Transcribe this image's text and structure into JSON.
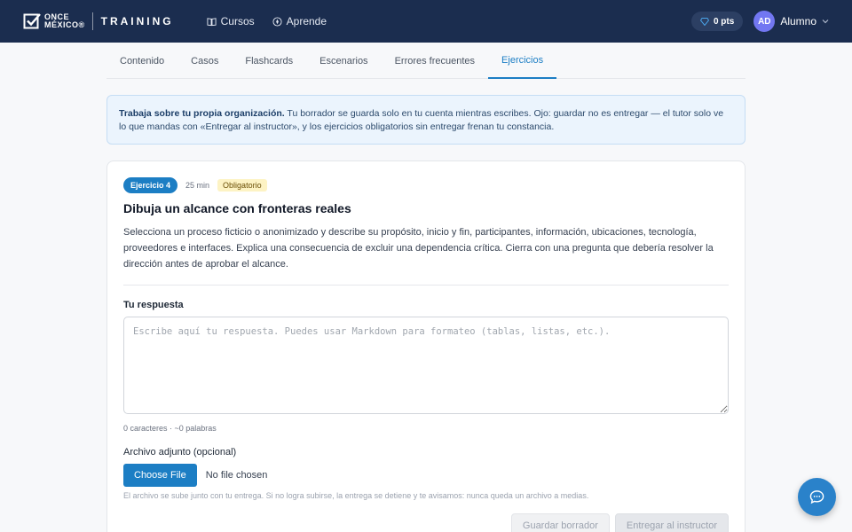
{
  "header": {
    "logo_line1": "ONCE",
    "logo_line2": "MÉXICO®",
    "brand": "TRAINING",
    "nav": [
      {
        "label": "Cursos",
        "icon": "book-icon"
      },
      {
        "label": "Aprende",
        "icon": "compass-icon"
      }
    ],
    "points": "0 pts",
    "user_initials": "AD",
    "user_name": "Alumno"
  },
  "tabs": [
    {
      "label": "Contenido",
      "active": false
    },
    {
      "label": "Casos",
      "active": false
    },
    {
      "label": "Flashcards",
      "active": false
    },
    {
      "label": "Escenarios",
      "active": false
    },
    {
      "label": "Errores frecuentes",
      "active": false
    },
    {
      "label": "Ejercicios",
      "active": true
    }
  ],
  "banner": {
    "bold": "Trabaja sobre tu propia organización.",
    "text": " Tu borrador se guarda solo en tu cuenta mientras escribes. Ojo: guardar no es entregar — el tutor solo ve lo que mandas con «Entregar al instructor», y los ejercicios obligatorios sin entregar frenan tu constancia."
  },
  "exercise": {
    "badge": "Ejercicio 4",
    "duration": "25 min",
    "required": "Obligatorio",
    "title": "Dibuja un alcance con fronteras reales",
    "description": "Selecciona un proceso ficticio o anonimizado y describe su propósito, inicio y fin, participantes, información, ubicaciones, tecnología, proveedores e interfaces. Explica una consecuencia de excluir una dependencia crítica. Cierra con una pregunta que debería resolver la dirección antes de aprobar el alcance.",
    "answer_label": "Tu respuesta",
    "answer_placeholder": "Escribe aquí tu respuesta. Puedes usar Markdown para formateo (tablas, listas, etc.).",
    "answer_value": "",
    "counter": "0 caracteres · ~0 palabras",
    "attachment_label": "Archivo adjunto (opcional)",
    "file_button": "Choose File",
    "file_status": "No file chosen",
    "attachment_hint": "El archivo se sube junto con tu entrega. Si no logra subirse, la entrega se detiene y te avisamos: nunca queda un archivo a medias.",
    "save_label": "Guardar borrador",
    "submit_label": "Entregar al instructor"
  },
  "colors": {
    "header_bg": "#1b2d4f",
    "accent": "#1c7ec4",
    "avatar": "#7277f2"
  }
}
